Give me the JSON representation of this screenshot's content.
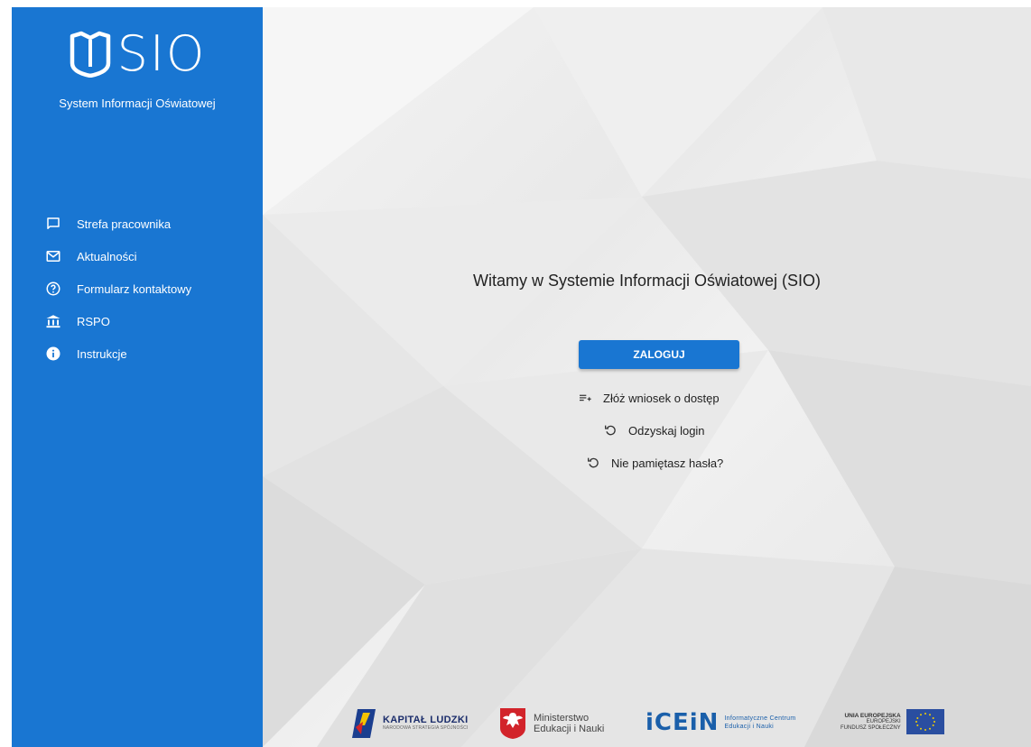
{
  "brand": {
    "logo_text": "SIO",
    "subtitle": "System Informacji Oświatowej"
  },
  "sidebar": {
    "items": [
      {
        "label": "Strefa pracownika",
        "icon": "chat-bubble-icon"
      },
      {
        "label": "Aktualności",
        "icon": "envelope-icon"
      },
      {
        "label": "Formularz kontaktowy",
        "icon": "help-circle-icon"
      },
      {
        "label": "RSPO",
        "icon": "institution-icon"
      },
      {
        "label": "Instrukcje",
        "icon": "info-icon"
      }
    ]
  },
  "main": {
    "welcome": "Witamy w Systemie Informacji Oświatowej (SIO)",
    "login_label": "ZALOGUJ",
    "links": [
      {
        "label": "Złóż wniosek o dostęp",
        "icon": "playlist-add-icon"
      },
      {
        "label": "Odzyskaj login",
        "icon": "restore-icon"
      },
      {
        "label": "Nie pamiętasz hasła?",
        "icon": "restore-icon"
      }
    ]
  },
  "footer": {
    "kl_title": "KAPITAŁ LUDZKI",
    "kl_sub": "NARODOWA STRATEGIA SPÓJNOŚCI",
    "men_line1": "Ministerstwo",
    "men_line2": "Edukacji i Nauki",
    "icein_big": "iCEiN",
    "icein_line1": "Informatyczne Centrum",
    "icein_line2": "Edukacji i Nauki",
    "ue_line1": "UNIA EUROPEJSKA",
    "ue_line2": "EUROPEJSKI",
    "ue_line3": "FUNDUSZ SPOŁECZNY"
  },
  "colors": {
    "primary": "#1976d2",
    "background": "#ececec"
  }
}
